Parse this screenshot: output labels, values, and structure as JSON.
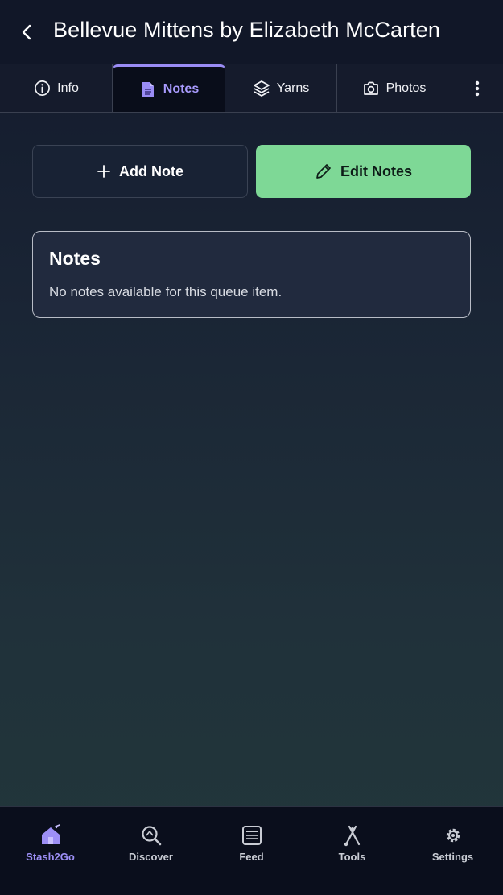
{
  "header": {
    "title": "Bellevue Mittens by Elizabeth McCarten",
    "back_icon": "chevron-left-icon"
  },
  "tabs": [
    {
      "label": "Info",
      "icon": "info-circle-icon",
      "active": false
    },
    {
      "label": "Notes",
      "icon": "document-icon",
      "active": true
    },
    {
      "label": "Yarns",
      "icon": "layers-icon",
      "active": false
    },
    {
      "label": "Photos",
      "icon": "camera-icon",
      "active": false
    },
    {
      "label": "",
      "icon": "more-vertical-icon",
      "active": false
    }
  ],
  "actions": {
    "add_label": "Add Note",
    "edit_label": "Edit Notes"
  },
  "notes_card": {
    "title": "Notes",
    "empty_text": "No notes available for this queue item."
  },
  "bottom_nav": [
    {
      "label": "Stash2Go",
      "icon": "home-icon",
      "active": true
    },
    {
      "label": "Discover",
      "icon": "discover-search-icon",
      "active": false
    },
    {
      "label": "Feed",
      "icon": "feed-icon",
      "active": false
    },
    {
      "label": "Tools",
      "icon": "tools-icon",
      "active": false
    },
    {
      "label": "Settings",
      "icon": "gear-icon",
      "active": false
    }
  ],
  "colors": {
    "accent": "#9d8ff6",
    "edit_button": "#7ed896",
    "background_top": "#131a2c",
    "background_bottom": "#22373b"
  }
}
